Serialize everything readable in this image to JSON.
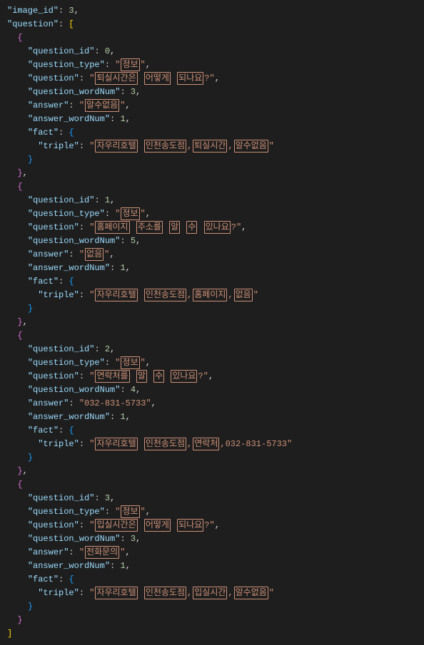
{
  "image_id_key": "image_id",
  "image_id_val": "3",
  "question_key": "question",
  "questions": [
    {
      "qid_key": "question_id",
      "qid_val": "0",
      "qtype_key": "question_type",
      "qtype_val": "정보",
      "q_key": "question",
      "q_parts": [
        "퇴실시간은",
        "어떻게",
        "되나요",
        "?"
      ],
      "qwn_key": "question_wordNum",
      "qwn_val": "3",
      "ans_key": "answer",
      "ans_parts": [
        "알수없음"
      ],
      "awn_key": "answer_wordNum",
      "awn_val": "1",
      "fact_key": "fact",
      "triple_key": "triple",
      "triple_parts": [
        "자우리호텔",
        "인천송도점",
        ",",
        "퇴실시간",
        ",",
        "알수없음"
      ]
    },
    {
      "qid_key": "question_id",
      "qid_val": "1",
      "qtype_key": "question_type",
      "qtype_val": "정보",
      "q_key": "question",
      "q_parts": [
        "홈페이지",
        "주소를",
        "알",
        "수",
        "있나요",
        "?"
      ],
      "qwn_key": "question_wordNum",
      "qwn_val": "5",
      "ans_key": "answer",
      "ans_parts": [
        "없음"
      ],
      "awn_key": "answer_wordNum",
      "awn_val": "1",
      "fact_key": "fact",
      "triple_key": "triple",
      "triple_parts": [
        "자우리호텔",
        "인천송도점",
        ",",
        "홈페이지",
        ",",
        "없음"
      ]
    },
    {
      "qid_key": "question_id",
      "qid_val": "2",
      "qtype_key": "question_type",
      "qtype_val": "정보",
      "q_key": "question",
      "q_parts": [
        "연락처를",
        "알",
        "수",
        "있나요",
        "?"
      ],
      "qwn_key": "question_wordNum",
      "qwn_val": "4",
      "ans_key": "answer",
      "ans_plain": "032-831-5733",
      "awn_key": "answer_wordNum",
      "awn_val": "1",
      "fact_key": "fact",
      "triple_key": "triple",
      "triple_parts": [
        "자우리호텔",
        "인천송도점",
        ",",
        "연락처",
        ",",
        "$plain:032-831-5733"
      ]
    },
    {
      "qid_key": "question_id",
      "qid_val": "3",
      "qtype_key": "question_type",
      "qtype_val": "정보",
      "q_key": "question",
      "q_parts": [
        "입실시간은",
        "어떻게",
        "되나요",
        "?"
      ],
      "qwn_key": "question_wordNum",
      "qwn_val": "3",
      "ans_key": "answer",
      "ans_parts": [
        "전화문의"
      ],
      "awn_key": "answer_wordNum",
      "awn_val": "1",
      "fact_key": "fact",
      "triple_key": "triple",
      "triple_parts": [
        "자우리호텔",
        "인천송도점",
        ",",
        "입실시간",
        ",",
        "알수없음"
      ]
    }
  ]
}
